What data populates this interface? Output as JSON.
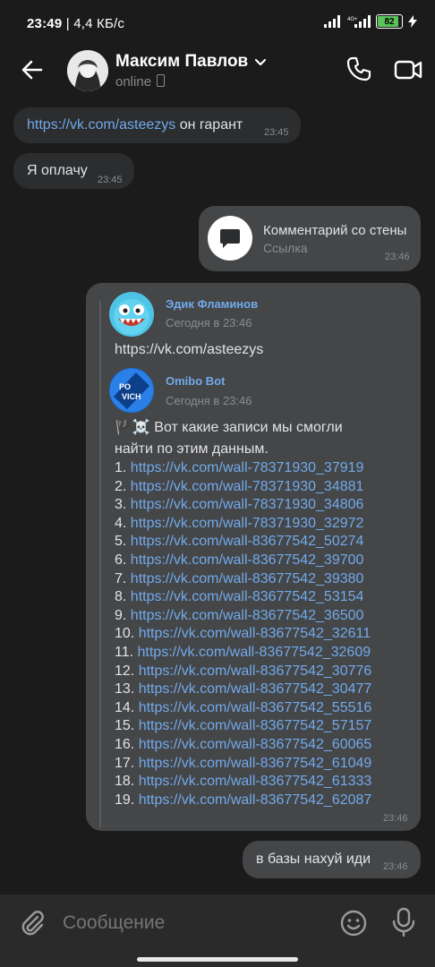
{
  "status_bar": {
    "time": "23:49",
    "speed": "| 4,4 КБ/с",
    "battery": "82"
  },
  "header": {
    "contact_name": "Максим Павлов",
    "presence": "online"
  },
  "messages": [
    {
      "link": "https://vk.com/asteezys",
      "text": " он гарант",
      "time": "23:45"
    },
    {
      "text": "Я оплачу",
      "time": "23:45"
    },
    {
      "title": "Комментарий со стены",
      "subtitle": "Ссылка",
      "time": "23:46"
    },
    {
      "time": "23:46",
      "forward1": {
        "name": "Эдик Фламинов",
        "date": "Сегодня в 23:46",
        "text": "https://vk.com/asteezys"
      },
      "forward2": {
        "name": "Omibo Bot",
        "date": "Сегодня в 23:46",
        "intro1": "🏴☠️ Вот какие записи мы смогли",
        "intro2": "найти по этим данным.",
        "links": [
          {
            "n": "1. ",
            "url": "https://vk.com/wall-78371930_37919"
          },
          {
            "n": "2. ",
            "url": "https://vk.com/wall-78371930_34881"
          },
          {
            "n": "3. ",
            "url": "https://vk.com/wall-78371930_34806"
          },
          {
            "n": "4. ",
            "url": "https://vk.com/wall-78371930_32972"
          },
          {
            "n": "5. ",
            "url": "https://vk.com/wall-83677542_50274"
          },
          {
            "n": "6. ",
            "url": "https://vk.com/wall-83677542_39700"
          },
          {
            "n": "7. ",
            "url": "https://vk.com/wall-83677542_39380"
          },
          {
            "n": "8. ",
            "url": "https://vk.com/wall-83677542_53154"
          },
          {
            "n": "9. ",
            "url": "https://vk.com/wall-83677542_36500"
          },
          {
            "n": "10. ",
            "url": "https://vk.com/wall-83677542_32611"
          },
          {
            "n": "11. ",
            "url": "https://vk.com/wall-83677542_32609"
          },
          {
            "n": "12. ",
            "url": "https://vk.com/wall-83677542_30776"
          },
          {
            "n": "13. ",
            "url": "https://vk.com/wall-83677542_30477"
          },
          {
            "n": "14. ",
            "url": "https://vk.com/wall-83677542_55516"
          },
          {
            "n": "15. ",
            "url": "https://vk.com/wall-83677542_57157"
          },
          {
            "n": "16. ",
            "url": "https://vk.com/wall-83677542_60065"
          },
          {
            "n": "17. ",
            "url": "https://vk.com/wall-83677542_61049"
          },
          {
            "n": "18. ",
            "url": "https://vk.com/wall-83677542_61333"
          },
          {
            "n": "19. ",
            "url": "https://vk.com/wall-83677542_62087"
          }
        ]
      }
    },
    {
      "text": "в базы нахуй иди",
      "time": "23:46"
    }
  ],
  "composer": {
    "placeholder": "Сообщение"
  },
  "icons": [
    "back-arrow-icon",
    "chevron-down-icon",
    "phone-icon",
    "video-camera-icon",
    "comment-icon",
    "paperclip-icon",
    "smile-icon",
    "microphone-icon"
  ]
}
